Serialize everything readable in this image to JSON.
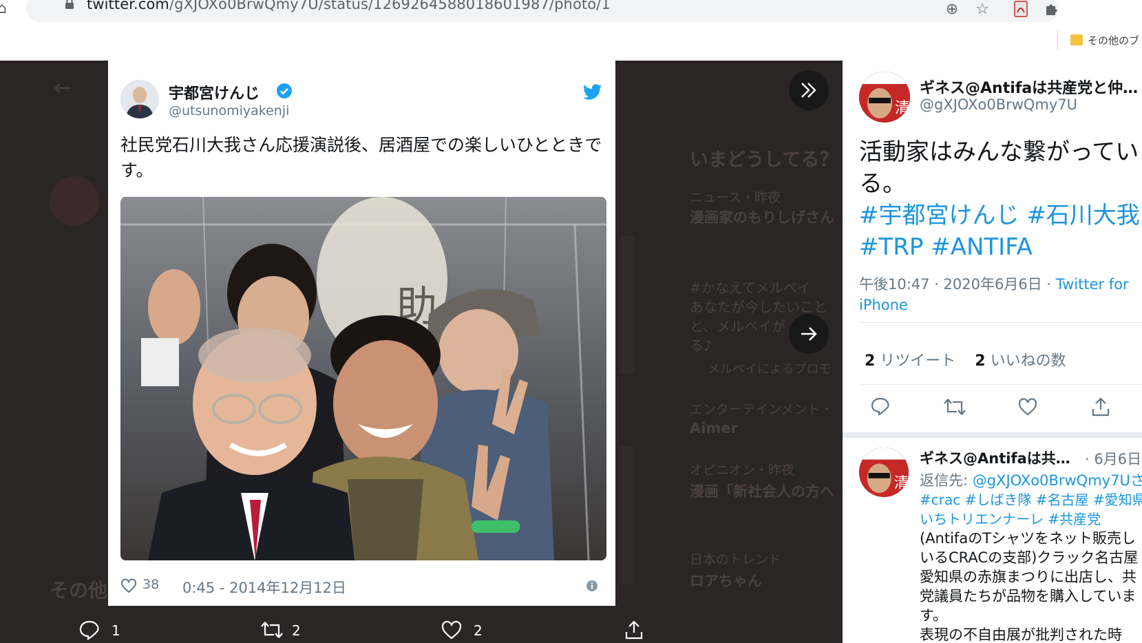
{
  "browser": {
    "url_host": "twitter.com",
    "url_path": "/gXJOXo0BrwQmy7U/status/1269264588018601987/photo/1",
    "bookmark_other": "その他のブ"
  },
  "background": {
    "whats_happening": "いまどうしてる？",
    "trend1_meta": "ニュース・昨夜",
    "trend1_title": "漫画家のもりしげさん",
    "promo_tag": "#かなえてメルペイ",
    "promo_l1": "あなたが今したいこと",
    "promo_l2": "と、メルペイが",
    "promo_l3": "る♪",
    "promo_by": "メルペイによるプロモ",
    "ent_meta": "エンターテインメント・",
    "ent_title": "Aimer",
    "opinion_meta": "オピニオン・昨夜",
    "opinion_title": "漫画「新社会人の方へ",
    "jp_trend_meta": "日本のトレンド",
    "jp_trend_title": "ロアちゃん",
    "other_tweets": "その他のツイート"
  },
  "card": {
    "name": "宇都宮けんじ",
    "handle": "@utsunomiyakenji",
    "text": "社民党石川大我さん応援演説後、居酒屋での楽しいひとときです。",
    "likes": "38",
    "date": "0:45 - 2014年12月12日"
  },
  "bottom_bar": {
    "replies": "1",
    "retweets": "2",
    "likes": "2"
  },
  "right": {
    "name": "ギネス@Antifaは共産党と仲…",
    "handle": "@gXJOXo0BrwQmy7U",
    "text_plain": "活動家はみんな繋がっている。",
    "tag1": "#宇都宮けんじ",
    "tag2": "#石川大我",
    "tag3": "#TRP",
    "tag4": "#ANTIFA",
    "time": "午後10:47 · 2020年6月6日 · ",
    "source": "Twitter for iPhone",
    "retweet_count": "2",
    "retweet_label": " リツイート",
    "like_count": "2",
    "like_label": " いいねの数",
    "reply": {
      "name": "ギネス@Antifaは共…",
      "date": "· 6月6日",
      "reply_prefix": "返信先: ",
      "reply_to": "@gXJOXo0BrwQmy7Uさ",
      "tags": "#crac #しばき隊 #名古屋 #愛知県 いちトリエンナーレ #共産党",
      "body": "(AntifaのTシャツをネット販売し\nいるCRACの支部)クラック名古屋\n愛知県の赤旗まつりに出店し、共\n党議員たちが品物を購入していま\nす。\n表現の不自由展が批判された時"
    }
  }
}
